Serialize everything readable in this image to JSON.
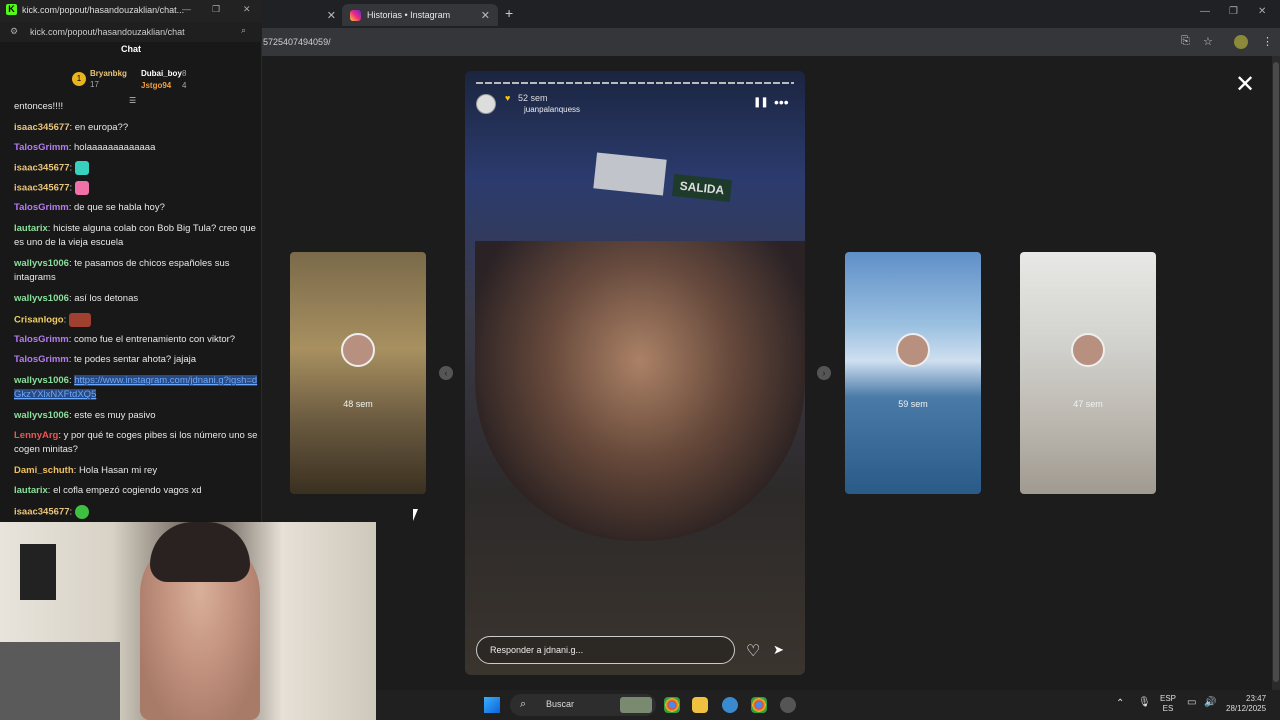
{
  "browser": {
    "tabs": [
      {
        "label": ""
      },
      {
        "label": "Historias • Instagram"
      }
    ],
    "url_partial": "5725407494059/"
  },
  "kick_popout": {
    "window_title": "kick.com/popout/hasandouzaklian/chat...",
    "url": "kick.com/popout/hasandouzaklian/chat",
    "chat_heading": "Chat",
    "top_gifters": [
      {
        "name": "Bryanbkg",
        "count": "17"
      },
      {
        "name": "Dubai_boy",
        "count": "8"
      },
      {
        "name": "Jstgo94",
        "count": "4"
      }
    ],
    "messages": [
      {
        "user": "",
        "text": "entonces!!!!"
      },
      {
        "user": "isaac345677",
        "text": "en europa??"
      },
      {
        "user": "TalosGrimm",
        "text": "holaaaaaaaaaaaaa"
      },
      {
        "user": "isaac345677",
        "text": ""
      },
      {
        "user": "isaac345677",
        "text": ""
      },
      {
        "user": "TalosGrimm",
        "text": "de que se habla hoy?"
      },
      {
        "user": "lautarix",
        "text": "hiciste alguna colab con Bob Big Tula? creo que es uno de la vieja escuela"
      },
      {
        "user": "wallyvs1006",
        "text": "te pasamos de chicos españoles sus intagrams"
      },
      {
        "user": "wallyvs1006",
        "text": "así los detonas"
      },
      {
        "user": "Crisanlogo",
        "text": ""
      },
      {
        "user": "TalosGrimm",
        "text": "como fue el entrenamiento con viktor?"
      },
      {
        "user": "TalosGrimm",
        "text": "te podes sentar ahota? jajaja"
      },
      {
        "user": "wallyvs1006",
        "text": "https://www.instagram.com/jdnani.g?igsh=dGkzYXlxNXFtdXQ5"
      },
      {
        "user": "wallyvs1006",
        "text": "este es muy pasivo"
      },
      {
        "user": "LennyArg",
        "text": "y por qué te coges pibes si los número uno se cogen minitas?"
      },
      {
        "user": "Dami_schuth",
        "text": "Hola Hasan mi rey"
      },
      {
        "user": "lautarix",
        "text": "el cofla empezó cogiendo vagos xd"
      },
      {
        "user": "isaac345677",
        "text": ""
      }
    ]
  },
  "story": {
    "time_ago": "52 sem",
    "audio_user": "juanpalanquess",
    "sign_text": "SALIDA",
    "reply_placeholder": "Responder a jdnani.g...",
    "side_stories": [
      {
        "ago": "48 sem"
      },
      {
        "ago": "59 sem"
      },
      {
        "ago": "47 sem"
      }
    ]
  },
  "taskbar": {
    "search_label": "Buscar",
    "lang_top": "ESP",
    "lang_bottom": "ES",
    "time": "23:47",
    "date": "28/12/2025"
  },
  "colors": {
    "kick_green": "#53fc18",
    "instagram_gradient_start": "#f9ce34",
    "link_blue": "#6aa8ff"
  }
}
